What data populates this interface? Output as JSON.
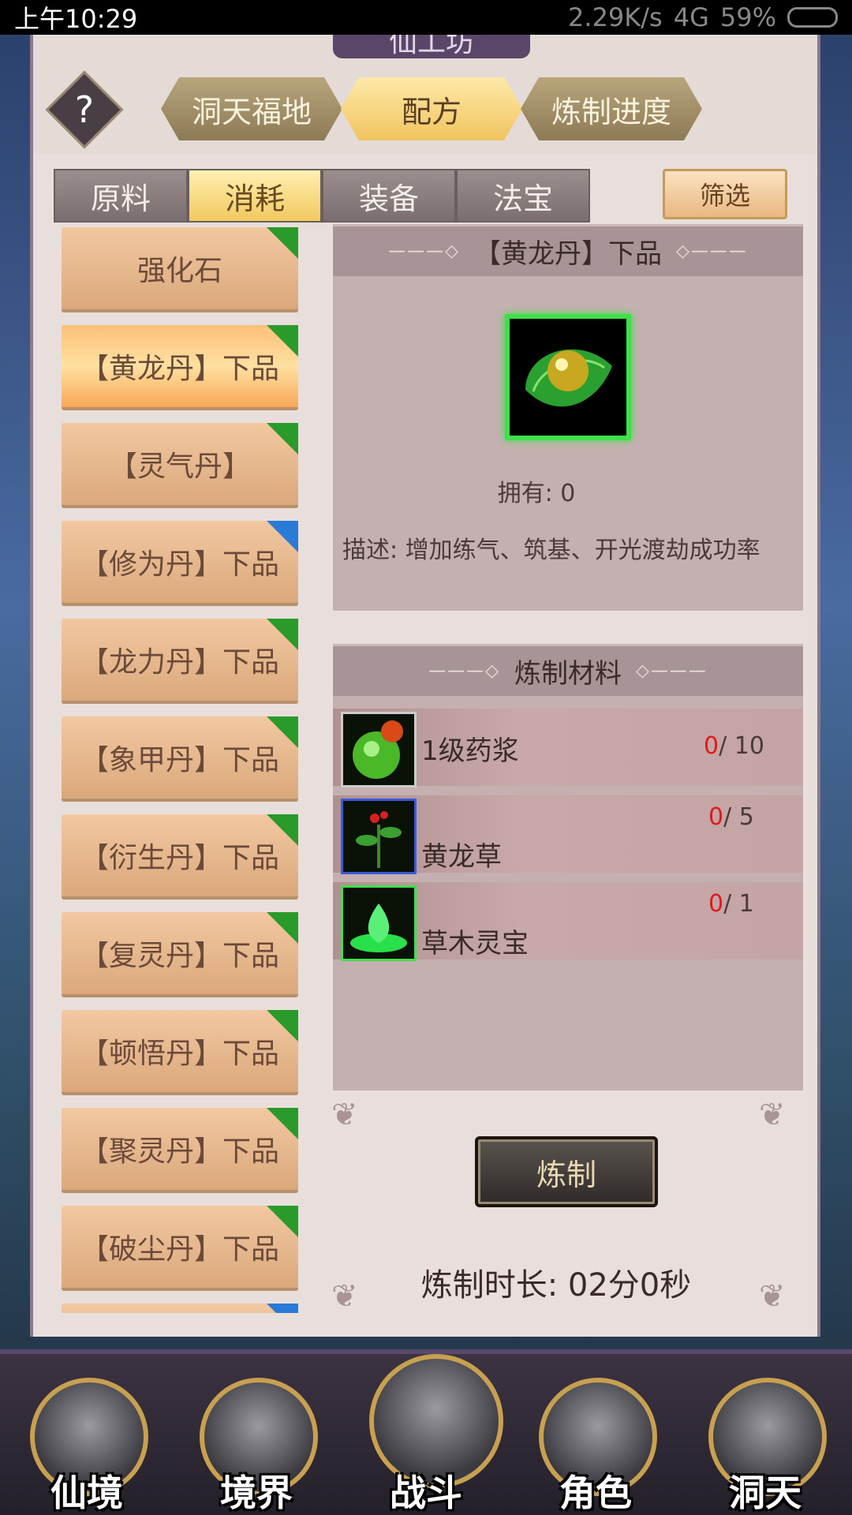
{
  "status": {
    "time": "上午10:29",
    "net": "2.29K/s",
    "carrier": "4G",
    "battery": "59%"
  },
  "window": {
    "title": "仙工坊"
  },
  "main_tabs": [
    {
      "label": "洞天福地",
      "active": false
    },
    {
      "label": "配方",
      "active": true
    },
    {
      "label": "炼制进度",
      "active": false
    }
  ],
  "help": {
    "label": "?"
  },
  "sub_tabs": [
    {
      "label": "原料",
      "active": false
    },
    {
      "label": "消耗",
      "active": true
    },
    {
      "label": "装备",
      "active": false
    },
    {
      "label": "法宝",
      "active": false
    }
  ],
  "filter": {
    "label": "筛选"
  },
  "recipes": [
    {
      "label": "强化石",
      "badge": "green"
    },
    {
      "label": "【黄龙丹】下品",
      "badge": "green",
      "selected": true
    },
    {
      "label": "【灵气丹】",
      "badge": "green"
    },
    {
      "label": "【修为丹】下品",
      "badge": "blue"
    },
    {
      "label": "【龙力丹】下品",
      "badge": "green"
    },
    {
      "label": "【象甲丹】下品",
      "badge": "green"
    },
    {
      "label": "【衍生丹】下品",
      "badge": "green"
    },
    {
      "label": "【复灵丹】下品",
      "badge": "green"
    },
    {
      "label": "【顿悟丹】下品",
      "badge": "green"
    },
    {
      "label": "【聚灵丹】下品",
      "badge": "green"
    },
    {
      "label": "【破尘丹】下品",
      "badge": "green"
    }
  ],
  "detail": {
    "name": "【黄龙丹】下品",
    "own_label": "拥有: 0",
    "description": "描述: 增加练气、筑基、开光渡劫成功率",
    "materials_title": "炼制材料",
    "materials": [
      {
        "name": "1级药浆",
        "have": "0",
        "need": "/ 10",
        "frame": "gray"
      },
      {
        "name": "黄龙草",
        "have": "0",
        "need": "/ 5",
        "frame": "blue"
      },
      {
        "name": "草木灵宝",
        "have": "0",
        "need": "/ 1",
        "frame": "green"
      }
    ],
    "craft_label": "炼制",
    "craft_time": "炼制时长: 02分0秒"
  },
  "bottom_nav": [
    {
      "label": "仙境"
    },
    {
      "label": "境界"
    },
    {
      "label": "战斗"
    },
    {
      "label": "角色"
    },
    {
      "label": "洞天"
    }
  ],
  "colors": {
    "badge_green": "#2a9a2a",
    "badge_blue": "#2a7ad8",
    "count_have": "#e01a1a"
  }
}
